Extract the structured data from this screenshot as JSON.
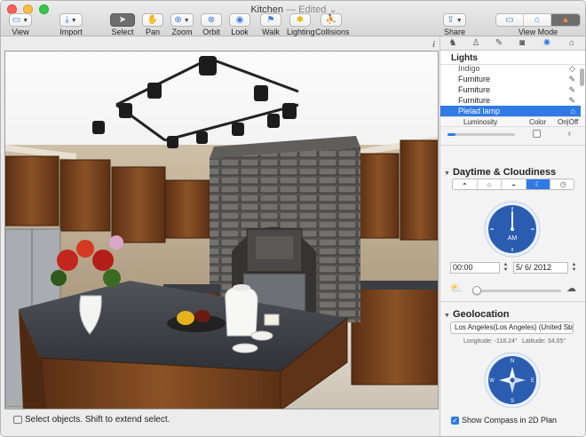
{
  "window": {
    "title": "Kitchen",
    "edited": "— Edited",
    "title_caret": "⌄"
  },
  "toolbar": {
    "view": "View",
    "import": "Import",
    "select": "Select",
    "pan": "Pan",
    "zoom": "Zoom",
    "orbit": "Orbit",
    "look": "Look",
    "walk": "Walk",
    "lighting": "Lighting",
    "collisions": "Collisions",
    "share": "Share",
    "view_mode": "View Mode"
  },
  "status": {
    "text": "Select objects. Shift to extend select."
  },
  "panel": {
    "tabs": [
      "furniture-icon",
      "build-icon",
      "paint-icon",
      "camera-icon",
      "light-icon",
      "house-icon"
    ],
    "active_tab": "light-icon",
    "lights": {
      "title": "Lights",
      "items": [
        {
          "name": "Indigo",
          "icon": "◇"
        },
        {
          "name": "Furniture",
          "icon": "✎"
        },
        {
          "name": "Furniture",
          "icon": "✎"
        },
        {
          "name": "Furniture",
          "icon": "✎"
        },
        {
          "name": "Plelad lamp",
          "icon": "⌂",
          "selected": true
        }
      ],
      "columns": {
        "luminosity": "Luminosity",
        "color": "Color",
        "onoff": "On|Off"
      },
      "luminosity_fraction": 0.12
    },
    "daytime": {
      "title": "Daytime & Cloudiness",
      "segments": [
        "sunrise",
        "sun",
        "sunset",
        "night",
        "clock"
      ],
      "active_segment": 3,
      "clock_label": "AM",
      "time": "00:00",
      "date": "5/  6/ 2012",
      "cloudiness_fraction": 0.05
    },
    "geolocation": {
      "title": "Geolocation",
      "city": "Los Angeles(Los Angeles) (United Stat",
      "longitude": "Longitude: -118.24°",
      "latitude": "Latitude: 34.05°",
      "show_compass": "Show Compass in 2D Plan",
      "show_compass_checked": true
    }
  }
}
